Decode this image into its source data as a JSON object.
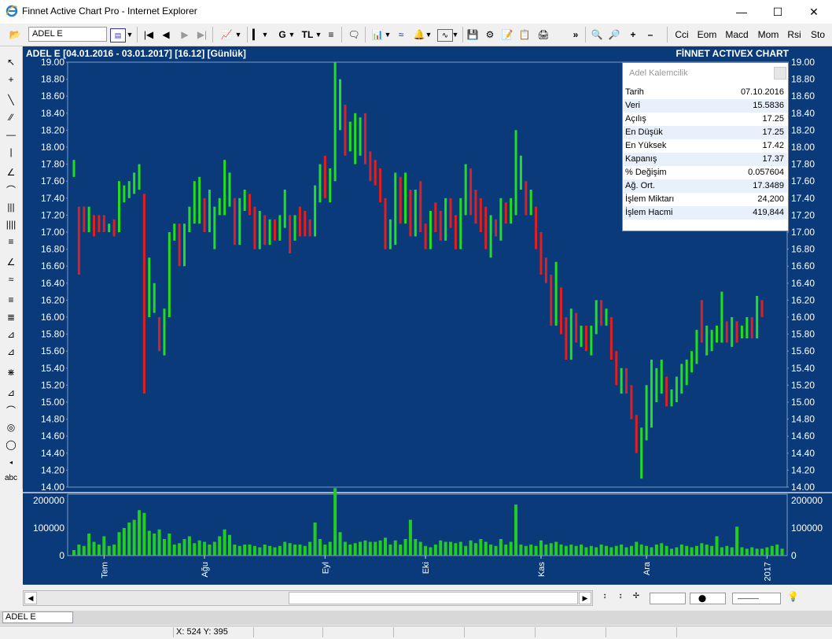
{
  "window": {
    "title": "Finnet Active Chart Pro - Internet Explorer"
  },
  "toolbar": {
    "symbol": "ADEL  E",
    "g_label": "G",
    "tl_label": "TL",
    "more": "»",
    "indicators": [
      "Cci",
      "Eom",
      "Macd",
      "Mom",
      "Rsi",
      "Sto"
    ]
  },
  "chart": {
    "header_left": "ADEL  E  [04.01.2016 - 03.01.2017]  [16.12]  [Günlük]",
    "header_right": "FİNNET ACTIVEX CHART",
    "colors": {
      "background": "#0a3a7a",
      "up": "#22dd22",
      "down": "#e02020",
      "volume": "#22cc22"
    }
  },
  "chart_data": {
    "type": "bar",
    "subtype": "ohlc",
    "price_axis": {
      "min": 14.0,
      "max": 19.0,
      "ticks": [
        "19.00",
        "18.80",
        "18.60",
        "18.40",
        "18.20",
        "18.00",
        "17.80",
        "17.60",
        "17.40",
        "17.20",
        "17.00",
        "16.80",
        "16.60",
        "16.40",
        "16.20",
        "16.00",
        "15.80",
        "15.60",
        "15.40",
        "15.20",
        "15.00",
        "14.80",
        "14.60",
        "14.40",
        "14.20",
        "14.00"
      ]
    },
    "volume_axis": {
      "min": 0,
      "max": 200000,
      "ticks": [
        "200000",
        "100000",
        "0"
      ]
    },
    "months": [
      {
        "label": "Tem",
        "index": 6
      },
      {
        "label": "Ağu",
        "index": 26
      },
      {
        "label": "Eyl",
        "index": 50
      },
      {
        "label": "Eki",
        "index": 70
      },
      {
        "label": "Kas",
        "index": 93
      },
      {
        "label": "Ara",
        "index": 114
      },
      {
        "label": "2017",
        "index": 138
      }
    ],
    "ohlc": [
      [
        17.7,
        17.85,
        17.65,
        17.8
      ],
      [
        17.3,
        17.3,
        16.5,
        16.6
      ],
      [
        17.25,
        17.3,
        17.0,
        17.05
      ],
      [
        17.1,
        17.3,
        17.0,
        17.25
      ],
      [
        17.2,
        17.2,
        16.95,
        17.05
      ],
      [
        17.15,
        17.2,
        17.0,
        17.05
      ],
      [
        17.15,
        17.2,
        17.0,
        17.1
      ],
      [
        17.05,
        17.1,
        17.0,
        17.1
      ],
      [
        17.1,
        17.15,
        16.95,
        17.0
      ],
      [
        17.0,
        17.6,
        17.0,
        17.5
      ],
      [
        17.45,
        17.55,
        17.35,
        17.5
      ],
      [
        17.4,
        17.6,
        17.4,
        17.55
      ],
      [
        17.5,
        17.7,
        17.45,
        17.65
      ],
      [
        17.6,
        17.8,
        17.5,
        17.75
      ],
      [
        17.45,
        17.45,
        15.1,
        15.5
      ],
      [
        16.0,
        16.7,
        16.0,
        16.2
      ],
      [
        16.0,
        16.4,
        16.05,
        16.35
      ],
      [
        16.0,
        16.0,
        15.6,
        15.65
      ],
      [
        15.6,
        16.1,
        15.55,
        16.05
      ],
      [
        16.05,
        17.0,
        16.0,
        16.9
      ],
      [
        16.95,
        17.1,
        16.9,
        17.0
      ],
      [
        16.9,
        17.1,
        16.6,
        16.65
      ],
      [
        16.65,
        17.1,
        16.6,
        17.0
      ],
      [
        17.0,
        17.3,
        17.0,
        17.2
      ],
      [
        17.2,
        17.6,
        17.1,
        17.55
      ],
      [
        17.2,
        17.65,
        17.1,
        17.5
      ],
      [
        17.4,
        17.4,
        17.0,
        17.1
      ],
      [
        17.05,
        17.5,
        17.0,
        17.45
      ],
      [
        16.8,
        17.3,
        16.8,
        17.25
      ],
      [
        17.25,
        17.4,
        17.2,
        17.3
      ],
      [
        17.25,
        17.85,
        17.2,
        17.8
      ],
      [
        17.4,
        17.7,
        17.3,
        17.4
      ],
      [
        17.3,
        17.4,
        16.85,
        16.9
      ],
      [
        16.9,
        17.4,
        16.85,
        17.35
      ],
      [
        17.3,
        17.5,
        17.25,
        17.45
      ],
      [
        17.45,
        17.45,
        17.2,
        17.25
      ],
      [
        17.25,
        17.3,
        16.8,
        16.85
      ],
      [
        16.85,
        17.25,
        16.8,
        17.2
      ],
      [
        17.15,
        17.2,
        16.85,
        16.9
      ],
      [
        16.9,
        17.15,
        16.85,
        17.1
      ],
      [
        17.05,
        17.15,
        16.9,
        16.95
      ],
      [
        17.0,
        17.2,
        16.9,
        17.15
      ],
      [
        17.15,
        17.5,
        17.05,
        17.4
      ],
      [
        17.2,
        17.2,
        16.75,
        16.8
      ],
      [
        16.9,
        17.2,
        16.9,
        17.15
      ],
      [
        17.05,
        17.3,
        16.95,
        17.0
      ],
      [
        17.1,
        17.25,
        16.95,
        17.05
      ],
      [
        17.05,
        17.15,
        16.95,
        17.0
      ],
      [
        16.95,
        17.55,
        16.95,
        17.4
      ],
      [
        17.4,
        17.8,
        17.35,
        17.75
      ],
      [
        17.9,
        17.9,
        17.4,
        17.45
      ],
      [
        17.4,
        17.75,
        17.35,
        17.55
      ],
      [
        17.6,
        19.0,
        17.6,
        18.3
      ],
      [
        18.3,
        18.8,
        18.2,
        18.5
      ],
      [
        18.5,
        18.5,
        17.9,
        18.0
      ],
      [
        18.05,
        18.3,
        17.95,
        18.2
      ],
      [
        17.9,
        18.4,
        17.8,
        18.05
      ],
      [
        18.1,
        18.35,
        17.9,
        18.3
      ],
      [
        18.4,
        18.4,
        17.8,
        17.95
      ],
      [
        17.85,
        17.95,
        17.6,
        17.65
      ],
      [
        17.7,
        17.85,
        17.55,
        17.6
      ],
      [
        17.55,
        17.75,
        17.35,
        17.4
      ],
      [
        17.4,
        17.4,
        16.8,
        16.85
      ],
      [
        16.85,
        17.15,
        16.8,
        17.1
      ],
      [
        17.1,
        17.7,
        16.85,
        17.6
      ],
      [
        17.55,
        17.65,
        17.1,
        17.2
      ],
      [
        17.2,
        17.7,
        17.1,
        17.6
      ],
      [
        17.2,
        17.5,
        16.95,
        17.0
      ],
      [
        17.0,
        17.5,
        16.95,
        17.4
      ],
      [
        17.5,
        17.6,
        17.0,
        17.1
      ],
      [
        17.1,
        17.1,
        16.8,
        16.85
      ],
      [
        16.85,
        17.25,
        16.8,
        17.2
      ],
      [
        17.2,
        17.35,
        17.0,
        17.1
      ],
      [
        17.1,
        17.25,
        16.9,
        16.95
      ],
      [
        17.0,
        17.4,
        16.9,
        17.35
      ],
      [
        17.4,
        17.4,
        17.05,
        17.1
      ],
      [
        17.1,
        17.2,
        16.8,
        16.85
      ],
      [
        16.85,
        17.4,
        16.8,
        17.3
      ],
      [
        17.25,
        17.8,
        17.2,
        17.7
      ],
      [
        17.7,
        17.75,
        17.2,
        17.3
      ],
      [
        17.3,
        17.5,
        17.1,
        17.2
      ],
      [
        17.2,
        17.4,
        17.0,
        17.1
      ],
      [
        17.1,
        17.3,
        16.8,
        16.9
      ],
      [
        16.9,
        17.2,
        16.7,
        17.1
      ],
      [
        17.1,
        17.15,
        16.95,
        17.0
      ],
      [
        17.0,
        17.4,
        16.9,
        17.3
      ],
      [
        17.3,
        17.35,
        17.1,
        17.2
      ],
      [
        17.2,
        17.4,
        17.1,
        17.3
      ],
      [
        17.25,
        18.2,
        17.2,
        17.6
      ],
      [
        17.6,
        17.9,
        17.5,
        17.8
      ],
      [
        17.6,
        17.6,
        17.2,
        17.3
      ],
      [
        17.3,
        17.5,
        17.2,
        17.4
      ],
      [
        17.3,
        17.3,
        16.8,
        16.85
      ],
      [
        16.85,
        17.0,
        16.5,
        16.6
      ],
      [
        16.6,
        16.7,
        16.4,
        16.45
      ],
      [
        16.45,
        16.5,
        15.9,
        15.95
      ],
      [
        15.95,
        16.65,
        15.9,
        16.3
      ],
      [
        16.3,
        16.35,
        15.8,
        15.85
      ],
      [
        15.8,
        16.0,
        15.5,
        15.55
      ],
      [
        15.55,
        16.1,
        15.5,
        16.0
      ],
      [
        16.0,
        16.05,
        15.7,
        15.75
      ],
      [
        15.75,
        15.9,
        15.65,
        15.8
      ],
      [
        15.8,
        15.9,
        15.6,
        15.65
      ],
      [
        15.6,
        15.9,
        15.55,
        15.85
      ],
      [
        15.85,
        16.2,
        15.8,
        16.15
      ],
      [
        16.15,
        16.2,
        15.9,
        15.95
      ],
      [
        15.95,
        16.1,
        15.9,
        16.05
      ],
      [
        16.0,
        16.0,
        15.5,
        15.55
      ],
      [
        15.55,
        15.6,
        15.2,
        15.25
      ],
      [
        15.25,
        15.4,
        15.1,
        15.35
      ],
      [
        15.35,
        15.4,
        15.1,
        15.15
      ],
      [
        15.15,
        15.2,
        14.8,
        14.85
      ],
      [
        14.85,
        14.85,
        14.4,
        14.45
      ],
      [
        14.45,
        14.7,
        14.1,
        14.65
      ],
      [
        14.65,
        15.2,
        14.55,
        14.75
      ],
      [
        14.75,
        15.5,
        14.7,
        15.1
      ],
      [
        15.1,
        15.4,
        15.0,
        15.25
      ],
      [
        15.25,
        15.5,
        15.1,
        15.45
      ],
      [
        15.2,
        15.3,
        14.95,
        15.05
      ],
      [
        15.05,
        15.15,
        14.95,
        15.1
      ],
      [
        15.1,
        15.3,
        15.0,
        15.2
      ],
      [
        15.2,
        15.45,
        15.1,
        15.4
      ],
      [
        15.3,
        15.5,
        15.2,
        15.4
      ],
      [
        15.4,
        15.6,
        15.35,
        15.55
      ],
      [
        15.5,
        15.85,
        15.45,
        15.8
      ],
      [
        15.8,
        16.2,
        15.7,
        15.65
      ],
      [
        15.6,
        15.9,
        15.55,
        15.85
      ],
      [
        15.75,
        15.85,
        15.6,
        15.8
      ],
      [
        15.8,
        15.9,
        15.7,
        15.85
      ],
      [
        15.75,
        16.3,
        15.7,
        15.8
      ],
      [
        15.8,
        15.95,
        15.7,
        15.75
      ],
      [
        15.7,
        16.0,
        15.65,
        15.9
      ],
      [
        15.85,
        15.95,
        15.7,
        15.8
      ],
      [
        15.8,
        15.9,
        15.75,
        15.85
      ],
      [
        15.85,
        16.0,
        15.75,
        15.95
      ],
      [
        15.95,
        16.0,
        15.75,
        15.8
      ],
      [
        15.8,
        16.25,
        15.75,
        16.2
      ],
      [
        16.2,
        16.2,
        16.0,
        16.05
      ]
    ],
    "volume": [
      20000,
      40000,
      35000,
      80000,
      50000,
      40000,
      70000,
      35000,
      40000,
      85000,
      100000,
      120000,
      130000,
      165000,
      155000,
      90000,
      80000,
      95000,
      60000,
      80000,
      40000,
      45000,
      60000,
      70000,
      45000,
      55000,
      50000,
      40000,
      50000,
      70000,
      95000,
      75000,
      40000,
      35000,
      40000,
      40000,
      35000,
      30000,
      40000,
      35000,
      30000,
      35000,
      50000,
      45000,
      40000,
      40000,
      35000,
      50000,
      120000,
      60000,
      40000,
      50000,
      245000,
      85000,
      50000,
      40000,
      45000,
      50000,
      55000,
      50000,
      50000,
      55000,
      65000,
      40000,
      55000,
      40000,
      60000,
      130000,
      60000,
      50000,
      35000,
      30000,
      40000,
      55000,
      50000,
      50000,
      45000,
      50000,
      35000,
      55000,
      45000,
      60000,
      50000,
      40000,
      35000,
      60000,
      40000,
      50000,
      185000,
      40000,
      35000,
      40000,
      35000,
      55000,
      40000,
      45000,
      50000,
      40000,
      35000,
      40000,
      35000,
      40000,
      30000,
      35000,
      30000,
      40000,
      35000,
      30000,
      35000,
      40000,
      30000,
      35000,
      50000,
      40000,
      35000,
      30000,
      40000,
      45000,
      35000,
      25000,
      30000,
      40000,
      35000,
      30000,
      35000,
      45000,
      40000,
      35000,
      70000,
      30000,
      35000,
      30000,
      105000,
      30000,
      25000,
      30000,
      25000,
      25000,
      30000,
      35000,
      40000,
      25000
    ]
  },
  "infopanel": {
    "title": "Adel Kalemcilik",
    "rows": [
      {
        "k": "Tarih",
        "v": "07.10.2016"
      },
      {
        "k": "Veri",
        "v": "15.5836"
      },
      {
        "k": "Açılış",
        "v": "17.25"
      },
      {
        "k": "En Düşük",
        "v": "17.25"
      },
      {
        "k": "En Yüksek",
        "v": "17.42"
      },
      {
        "k": "Kapanış",
        "v": "17.37"
      },
      {
        "k": "% Değişim",
        "v": "0.057604"
      },
      {
        "k": "Ağ. Ort.",
        "v": "17.3489"
      },
      {
        "k": "İşlem Miktarı",
        "v": "24,200"
      },
      {
        "k": "İşlem Hacmi",
        "v": "419,844"
      }
    ]
  },
  "left_tools": {
    "text_tool": "abc"
  },
  "statusrow": {
    "tab_label": "ADEL  E"
  },
  "statusbar": {
    "coords": "X: 524 Y: 395"
  }
}
